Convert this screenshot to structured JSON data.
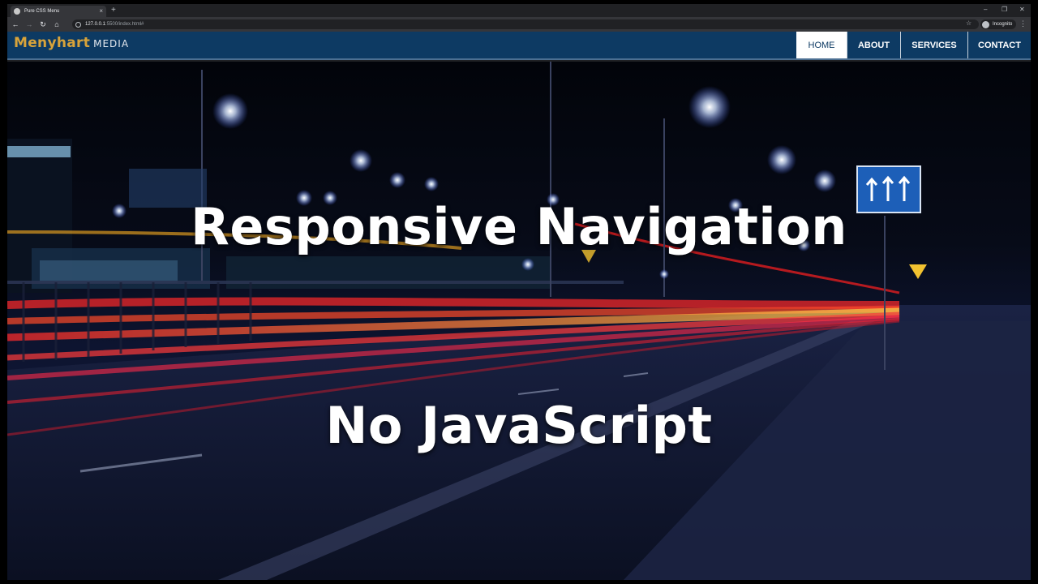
{
  "browser": {
    "tab_title": "Pure CSS Menu",
    "tab_close": "×",
    "new_tab": "+",
    "url_host": "127.0.0.1",
    "url_rest": ":5500/index.html#",
    "incognito_label": "Incognito",
    "controls": {
      "minimize": "–",
      "restore": "❐",
      "close": "✕"
    },
    "nav_glyphs": {
      "back": "←",
      "forward": "→",
      "reload": "↻",
      "home": "⌂",
      "star": "☆",
      "menu": "⋮"
    }
  },
  "site": {
    "logo_main": "Menyhart",
    "logo_sub": "MEDIA",
    "menu": [
      {
        "label": "HOME",
        "active": true
      },
      {
        "label": "ABOUT",
        "active": false
      },
      {
        "label": "SERVICES",
        "active": false
      },
      {
        "label": "CONTACT",
        "active": false
      }
    ]
  },
  "hero": {
    "title": "Responsive Navigation",
    "subtitle": "No JavaScript",
    "icons": [
      "street-light-icon",
      "road-sign-icon"
    ]
  },
  "colors": {
    "navbar": "#0d3a63",
    "logo_gold": "#d8a33a",
    "active_tab_bg": "#ffffff",
    "light_trail_red": "#ff3a2a",
    "light_trail_yellow": "#ffc23a"
  }
}
